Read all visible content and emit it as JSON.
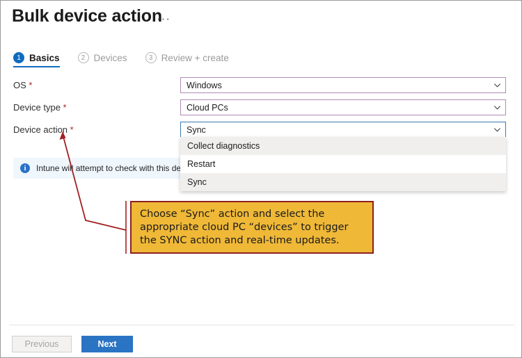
{
  "page": {
    "title": "Bulk device action",
    "overflow_menu": "···"
  },
  "wizard": {
    "steps": [
      {
        "number": "1",
        "label": "Basics",
        "state": "active"
      },
      {
        "number": "2",
        "label": "Devices",
        "state": "inactive"
      },
      {
        "number": "3",
        "label": "Review + create",
        "state": "inactive"
      }
    ]
  },
  "form": {
    "required_marker": "*",
    "fields": [
      {
        "label": "OS",
        "required": true,
        "value": "Windows",
        "state": "normal"
      },
      {
        "label": "Device type",
        "required": true,
        "value": "Cloud PCs",
        "state": "normal"
      },
      {
        "label": "Device action",
        "required": true,
        "value": "Sync",
        "state": "active-open"
      }
    ]
  },
  "dropdown": {
    "open_for": "Device action",
    "options": [
      {
        "label": "Collect diagnostics",
        "highlighted": true
      },
      {
        "label": "Restart",
        "highlighted": false
      },
      {
        "label": "Sync",
        "highlighted": true
      }
    ]
  },
  "info_banner": {
    "icon": "info-icon",
    "text": "Intune will attempt to check with this de"
  },
  "annotation": {
    "line1": "Choose “Sync” action and select the",
    "line2": "appropriate cloud PC “devices” to trigger",
    "line3": "the SYNC action and real-time updates.",
    "box_fill": "#efb837",
    "box_border": "#8b2020",
    "arrow_color": "#a31f21"
  },
  "footer": {
    "previous_label": "Previous",
    "next_label": "Next"
  },
  "colors": {
    "accent_blue": "#0f6cbd",
    "primary_button": "#2b74c4",
    "select_border": "#b08ab5",
    "select_border_active": "#3a78ad",
    "required_red": "#a4262c",
    "info_background": "#eff6fc"
  }
}
